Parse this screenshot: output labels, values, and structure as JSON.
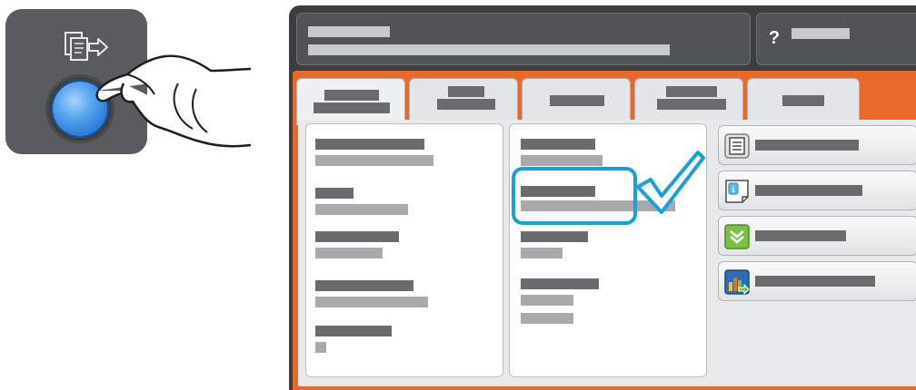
{
  "hardware": {
    "panel_icon": "services-home-icon",
    "button": "services-home-button",
    "hand": "pressing-hand"
  },
  "screen": {
    "title_area": {
      "lines": 2
    },
    "help_icon_glyph": "?",
    "tabs": [
      {
        "name": "tab-1",
        "active": true
      },
      {
        "name": "tab-2",
        "active": false
      },
      {
        "name": "tab-3",
        "active": false
      },
      {
        "name": "tab-4",
        "active": false
      },
      {
        "name": "tab-5",
        "active": false
      }
    ],
    "options": [
      {
        "icon": "job-list-icon"
      },
      {
        "icon": "information-icon"
      },
      {
        "icon": "supplies-icon"
      },
      {
        "icon": "billing-usage-icon"
      }
    ]
  },
  "colors": {
    "accent_orange": "#e9692a",
    "highlight_blue": "#1a9fd9",
    "button_blue": "#3b8ee3",
    "panel_gray": "#5a5b5e"
  }
}
